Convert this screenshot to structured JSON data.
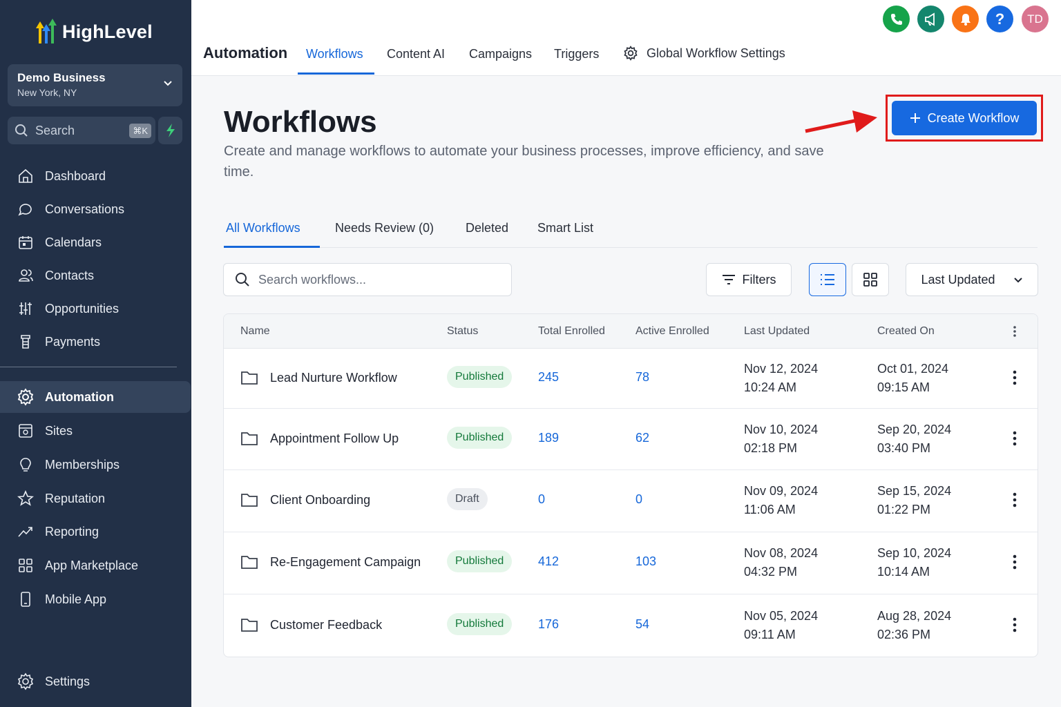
{
  "brand": {
    "name": "HighLevel"
  },
  "business": {
    "name": "Demo Business",
    "location": "New York, NY"
  },
  "sidebar_search": {
    "label": "Search",
    "shortcut": "⌘K"
  },
  "nav": [
    {
      "label": "Dashboard",
      "icon": "home-icon"
    },
    {
      "label": "Conversations",
      "icon": "chat-icon"
    },
    {
      "label": "Calendars",
      "icon": "calendar-icon"
    },
    {
      "label": "Contacts",
      "icon": "users-icon"
    },
    {
      "label": "Opportunities",
      "icon": "pipeline-icon"
    },
    {
      "label": "Payments",
      "icon": "payments-icon"
    }
  ],
  "nav2": [
    {
      "label": "Automation",
      "icon": "gear-icon",
      "active": true
    },
    {
      "label": "Sites",
      "icon": "sites-icon"
    },
    {
      "label": "Memberships",
      "icon": "membership-icon"
    },
    {
      "label": "Reputation",
      "icon": "star-icon"
    },
    {
      "label": "Reporting",
      "icon": "trend-icon"
    },
    {
      "label": "App Marketplace",
      "icon": "grid-icon"
    },
    {
      "label": "Mobile App",
      "icon": "phone-icon"
    }
  ],
  "settings": {
    "label": "Settings"
  },
  "topbar": {
    "title": "Automation",
    "tabs": [
      "Workflows",
      "Content AI",
      "Campaigns",
      "Triggers",
      "Global Workflow Settings"
    ],
    "active_tab": "Workflows",
    "avatar_initials": "TD",
    "help_label": "?"
  },
  "page": {
    "title": "Workflows",
    "description": "Create and manage workflows to automate your business processes, improve efficiency, and save time.",
    "create_button": "Create Workflow"
  },
  "subtabs": [
    "All Workflows",
    "Needs Review (0)",
    "Deleted",
    "Smart List"
  ],
  "toolbar": {
    "search_placeholder": "Search workflows...",
    "filters": "Filters",
    "sort": "Last Updated"
  },
  "table": {
    "headers": [
      "Name",
      "Status",
      "Total Enrolled",
      "Active Enrolled",
      "Last Updated",
      "Created On"
    ],
    "rows": [
      {
        "name": "Lead Nurture Workflow",
        "status": "Published",
        "total": "245",
        "active": "78",
        "updated_date": "Nov 12, 2024",
        "updated_time": "10:24 AM",
        "created_date": "Oct 01, 2024",
        "created_time": "09:15 AM"
      },
      {
        "name": "Appointment Follow Up",
        "status": "Published",
        "total": "189",
        "active": "62",
        "updated_date": "Nov 10, 2024",
        "updated_time": "02:18 PM",
        "created_date": "Sep 20, 2024",
        "created_time": "03:40 PM"
      },
      {
        "name": "Client Onboarding",
        "status": "Draft",
        "total": "0",
        "active": "0",
        "updated_date": "Nov 09, 2024",
        "updated_time": "11:06 AM",
        "created_date": "Sep 15, 2024",
        "created_time": "01:22 PM"
      },
      {
        "name": "Re-Engagement Campaign",
        "status": "Published",
        "total": "412",
        "active": "103",
        "updated_date": "Nov 08, 2024",
        "updated_time": "04:32 PM",
        "created_date": "Sep 10, 2024",
        "created_time": "10:14 AM"
      },
      {
        "name": "Customer Feedback",
        "status": "Published",
        "total": "176",
        "active": "54",
        "updated_date": "Nov 05, 2024",
        "updated_time": "09:11 AM",
        "created_date": "Aug 28, 2024",
        "created_time": "02:36 PM"
      }
    ]
  },
  "colors": {
    "sidebar": "#223047",
    "accent": "#1769e0",
    "highlight": "#e01b1b",
    "published": "#13793a"
  }
}
